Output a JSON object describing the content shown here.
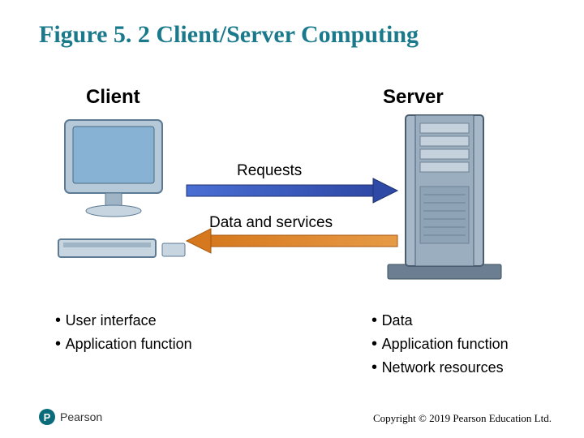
{
  "title": "Figure 5. 2 Client/Server Computing",
  "client": {
    "label": "Client",
    "bullets": [
      "User interface",
      "Application function"
    ]
  },
  "server": {
    "label": "Server",
    "bullets": [
      "Data",
      "Application function",
      "Network resources"
    ]
  },
  "arrows": {
    "requests": "Requests",
    "services": "Data and services"
  },
  "brand": {
    "badge": "P",
    "name": "Pearson"
  },
  "copyright": "Copyright © 2019 Pearson Education Ltd."
}
